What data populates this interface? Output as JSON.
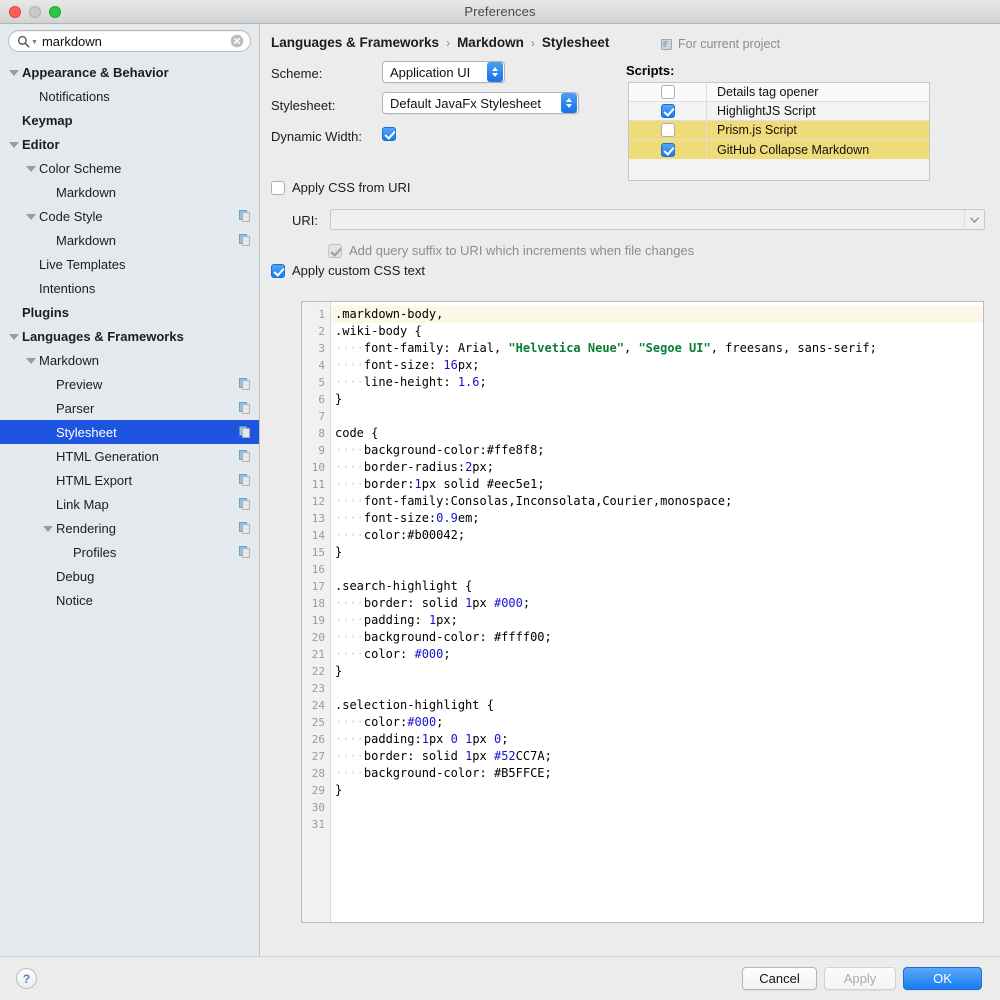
{
  "window": {
    "title": "Preferences"
  },
  "search": {
    "value": "markdown",
    "placeholder": "Search"
  },
  "sidebar": {
    "items": [
      {
        "label": "Appearance & Behavior",
        "indent": 0,
        "bold": true,
        "twisty": "open",
        "copy": false,
        "selected": false
      },
      {
        "label": "Notifications",
        "indent": 1,
        "bold": false,
        "twisty": "none",
        "copy": false,
        "selected": false
      },
      {
        "label": "Keymap",
        "indent": 0,
        "bold": true,
        "twisty": "none",
        "copy": false,
        "selected": false
      },
      {
        "label": "Editor",
        "indent": 0,
        "bold": true,
        "twisty": "open",
        "copy": false,
        "selected": false
      },
      {
        "label": "Color Scheme",
        "indent": 1,
        "bold": false,
        "twisty": "open",
        "copy": false,
        "selected": false
      },
      {
        "label": "Markdown",
        "indent": 2,
        "bold": false,
        "twisty": "none",
        "copy": false,
        "selected": false
      },
      {
        "label": "Code Style",
        "indent": 1,
        "bold": false,
        "twisty": "open",
        "copy": true,
        "selected": false
      },
      {
        "label": "Markdown",
        "indent": 2,
        "bold": false,
        "twisty": "none",
        "copy": true,
        "selected": false
      },
      {
        "label": "Live Templates",
        "indent": 1,
        "bold": false,
        "twisty": "none",
        "copy": false,
        "selected": false
      },
      {
        "label": "Intentions",
        "indent": 1,
        "bold": false,
        "twisty": "none",
        "copy": false,
        "selected": false
      },
      {
        "label": "Plugins",
        "indent": 0,
        "bold": true,
        "twisty": "none",
        "copy": false,
        "selected": false
      },
      {
        "label": "Languages & Frameworks",
        "indent": 0,
        "bold": true,
        "twisty": "open",
        "copy": false,
        "selected": false
      },
      {
        "label": "Markdown",
        "indent": 1,
        "bold": false,
        "twisty": "open",
        "copy": false,
        "selected": false
      },
      {
        "label": "Preview",
        "indent": 2,
        "bold": false,
        "twisty": "none",
        "copy": true,
        "selected": false
      },
      {
        "label": "Parser",
        "indent": 2,
        "bold": false,
        "twisty": "none",
        "copy": true,
        "selected": false
      },
      {
        "label": "Stylesheet",
        "indent": 2,
        "bold": false,
        "twisty": "none",
        "copy": true,
        "selected": true
      },
      {
        "label": "HTML Generation",
        "indent": 2,
        "bold": false,
        "twisty": "none",
        "copy": true,
        "selected": false
      },
      {
        "label": "HTML Export",
        "indent": 2,
        "bold": false,
        "twisty": "none",
        "copy": true,
        "selected": false
      },
      {
        "label": "Link Map",
        "indent": 2,
        "bold": false,
        "twisty": "none",
        "copy": true,
        "selected": false
      },
      {
        "label": "Rendering",
        "indent": 2,
        "bold": false,
        "twisty": "open",
        "copy": true,
        "selected": false
      },
      {
        "label": "Profiles",
        "indent": 3,
        "bold": false,
        "twisty": "none",
        "copy": true,
        "selected": false
      },
      {
        "label": "Debug",
        "indent": 2,
        "bold": false,
        "twisty": "none",
        "copy": false,
        "selected": false
      },
      {
        "label": "Notice",
        "indent": 2,
        "bold": false,
        "twisty": "none",
        "copy": false,
        "selected": false
      }
    ]
  },
  "breadcrumb": {
    "items": [
      "Languages & Frameworks",
      "Markdown",
      "Stylesheet"
    ],
    "separator": "›",
    "for_current_project": "For current project"
  },
  "form": {
    "scheme_label": "Scheme:",
    "scheme_value": "Application UI",
    "stylesheet_label": "Stylesheet:",
    "stylesheet_value": "Default JavaFx Stylesheet",
    "dynamic_width_label": "Dynamic Width:",
    "dynamic_width_checked": true,
    "apply_css_uri_label": "Apply CSS from URI",
    "apply_css_uri_checked": false,
    "uri_label": "URI:",
    "uri_value": "",
    "add_query_suffix_label": "Add query suffix to URI which increments when file changes",
    "add_query_suffix_checked": true,
    "add_query_suffix_enabled": false,
    "apply_custom_css_label": "Apply custom CSS text",
    "apply_custom_css_checked": true
  },
  "scripts": {
    "label": "Scripts:",
    "rows": [
      {
        "name": "Details tag opener",
        "checked": false,
        "highlighted": false
      },
      {
        "name": "HighlightJS Script",
        "checked": true,
        "highlighted": false
      },
      {
        "name": "Prism.js Script",
        "checked": false,
        "highlighted": true
      },
      {
        "name": "GitHub Collapse Markdown",
        "checked": true,
        "highlighted": true
      }
    ]
  },
  "editor": {
    "caret_line": 1,
    "lines": [
      {
        "n": 1,
        "tokens": [
          {
            "t": ".markdown-body,",
            "k": "p"
          }
        ]
      },
      {
        "n": 2,
        "tokens": [
          {
            "t": ".wiki-body {",
            "k": "p"
          }
        ]
      },
      {
        "n": 3,
        "tokens": [
          {
            "t": "····",
            "k": "w"
          },
          {
            "t": "font-family: Arial, ",
            "k": "p"
          },
          {
            "t": "\"Helvetica Neue\"",
            "k": "s"
          },
          {
            "t": ", ",
            "k": "p"
          },
          {
            "t": "\"Segoe UI\"",
            "k": "s"
          },
          {
            "t": ", freesans, sans-serif;",
            "k": "p"
          }
        ]
      },
      {
        "n": 4,
        "tokens": [
          {
            "t": "····",
            "k": "w"
          },
          {
            "t": "font-size: ",
            "k": "p"
          },
          {
            "t": "16",
            "k": "n"
          },
          {
            "t": "px;",
            "k": "p"
          }
        ]
      },
      {
        "n": 5,
        "tokens": [
          {
            "t": "····",
            "k": "w"
          },
          {
            "t": "line-height: ",
            "k": "p"
          },
          {
            "t": "1.6",
            "k": "n"
          },
          {
            "t": ";",
            "k": "p"
          }
        ]
      },
      {
        "n": 6,
        "tokens": [
          {
            "t": "}",
            "k": "p"
          }
        ]
      },
      {
        "n": 7,
        "tokens": []
      },
      {
        "n": 8,
        "tokens": [
          {
            "t": "code {",
            "k": "p"
          }
        ]
      },
      {
        "n": 9,
        "tokens": [
          {
            "t": "····",
            "k": "w"
          },
          {
            "t": "background-color:#ffe8f8;",
            "k": "p"
          }
        ]
      },
      {
        "n": 10,
        "tokens": [
          {
            "t": "····",
            "k": "w"
          },
          {
            "t": "border-radius:",
            "k": "p"
          },
          {
            "t": "2",
            "k": "n"
          },
          {
            "t": "px;",
            "k": "p"
          }
        ]
      },
      {
        "n": 11,
        "tokens": [
          {
            "t": "····",
            "k": "w"
          },
          {
            "t": "border:",
            "k": "p"
          },
          {
            "t": "1",
            "k": "n"
          },
          {
            "t": "px solid #eec5e1;",
            "k": "p"
          }
        ]
      },
      {
        "n": 12,
        "tokens": [
          {
            "t": "····",
            "k": "w"
          },
          {
            "t": "font-family:Consolas,Inconsolata,Courier,monospace;",
            "k": "p"
          }
        ]
      },
      {
        "n": 13,
        "tokens": [
          {
            "t": "····",
            "k": "w"
          },
          {
            "t": "font-size:",
            "k": "p"
          },
          {
            "t": "0.9",
            "k": "n"
          },
          {
            "t": "em;",
            "k": "p"
          }
        ]
      },
      {
        "n": 14,
        "tokens": [
          {
            "t": "····",
            "k": "w"
          },
          {
            "t": "color:#b00042;",
            "k": "p"
          }
        ]
      },
      {
        "n": 15,
        "tokens": [
          {
            "t": "}",
            "k": "p"
          }
        ]
      },
      {
        "n": 16,
        "tokens": []
      },
      {
        "n": 17,
        "tokens": [
          {
            "t": ".search-highlight {",
            "k": "p"
          }
        ]
      },
      {
        "n": 18,
        "tokens": [
          {
            "t": "····",
            "k": "w"
          },
          {
            "t": "border: solid ",
            "k": "p"
          },
          {
            "t": "1",
            "k": "n"
          },
          {
            "t": "px ",
            "k": "p"
          },
          {
            "t": "#000",
            "k": "n"
          },
          {
            "t": ";",
            "k": "p"
          }
        ]
      },
      {
        "n": 19,
        "tokens": [
          {
            "t": "····",
            "k": "w"
          },
          {
            "t": "padding: ",
            "k": "p"
          },
          {
            "t": "1",
            "k": "n"
          },
          {
            "t": "px;",
            "k": "p"
          }
        ]
      },
      {
        "n": 20,
        "tokens": [
          {
            "t": "····",
            "k": "w"
          },
          {
            "t": "background-color: #ffff00;",
            "k": "p"
          }
        ]
      },
      {
        "n": 21,
        "tokens": [
          {
            "t": "····",
            "k": "w"
          },
          {
            "t": "color: ",
            "k": "p"
          },
          {
            "t": "#000",
            "k": "n"
          },
          {
            "t": ";",
            "k": "p"
          }
        ]
      },
      {
        "n": 22,
        "tokens": [
          {
            "t": "}",
            "k": "p"
          }
        ]
      },
      {
        "n": 23,
        "tokens": []
      },
      {
        "n": 24,
        "tokens": [
          {
            "t": ".selection-highlight {",
            "k": "p"
          }
        ]
      },
      {
        "n": 25,
        "tokens": [
          {
            "t": "····",
            "k": "w"
          },
          {
            "t": "color:",
            "k": "p"
          },
          {
            "t": "#000",
            "k": "n"
          },
          {
            "t": ";",
            "k": "p"
          }
        ]
      },
      {
        "n": 26,
        "tokens": [
          {
            "t": "····",
            "k": "w"
          },
          {
            "t": "padding:",
            "k": "p"
          },
          {
            "t": "1",
            "k": "n"
          },
          {
            "t": "px ",
            "k": "p"
          },
          {
            "t": "0",
            "k": "n"
          },
          {
            "t": " ",
            "k": "p"
          },
          {
            "t": "1",
            "k": "n"
          },
          {
            "t": "px ",
            "k": "p"
          },
          {
            "t": "0",
            "k": "n"
          },
          {
            "t": ";",
            "k": "p"
          }
        ]
      },
      {
        "n": 27,
        "tokens": [
          {
            "t": "····",
            "k": "w"
          },
          {
            "t": "border: solid ",
            "k": "p"
          },
          {
            "t": "1",
            "k": "n"
          },
          {
            "t": "px ",
            "k": "p"
          },
          {
            "t": "#52",
            "k": "n"
          },
          {
            "t": "CC7A;",
            "k": "p"
          }
        ]
      },
      {
        "n": 28,
        "tokens": [
          {
            "t": "····",
            "k": "w"
          },
          {
            "t": "background-color: #B5FFCE;",
            "k": "p"
          }
        ]
      },
      {
        "n": 29,
        "tokens": [
          {
            "t": "}",
            "k": "p"
          }
        ]
      },
      {
        "n": 30,
        "tokens": []
      },
      {
        "n": 31,
        "tokens": []
      }
    ]
  },
  "footer": {
    "help_label": "?",
    "cancel_label": "Cancel",
    "apply_label": "Apply",
    "apply_enabled": false,
    "ok_label": "OK"
  },
  "colors": {
    "selection_blue": "#1e55e0",
    "accent_blue": "#1a7cf0",
    "row_highlight_yellow": "#f0db79",
    "caret_line": "#fdf7e5",
    "string_green": "#0a7d35",
    "number_blue": "#1414cc"
  }
}
